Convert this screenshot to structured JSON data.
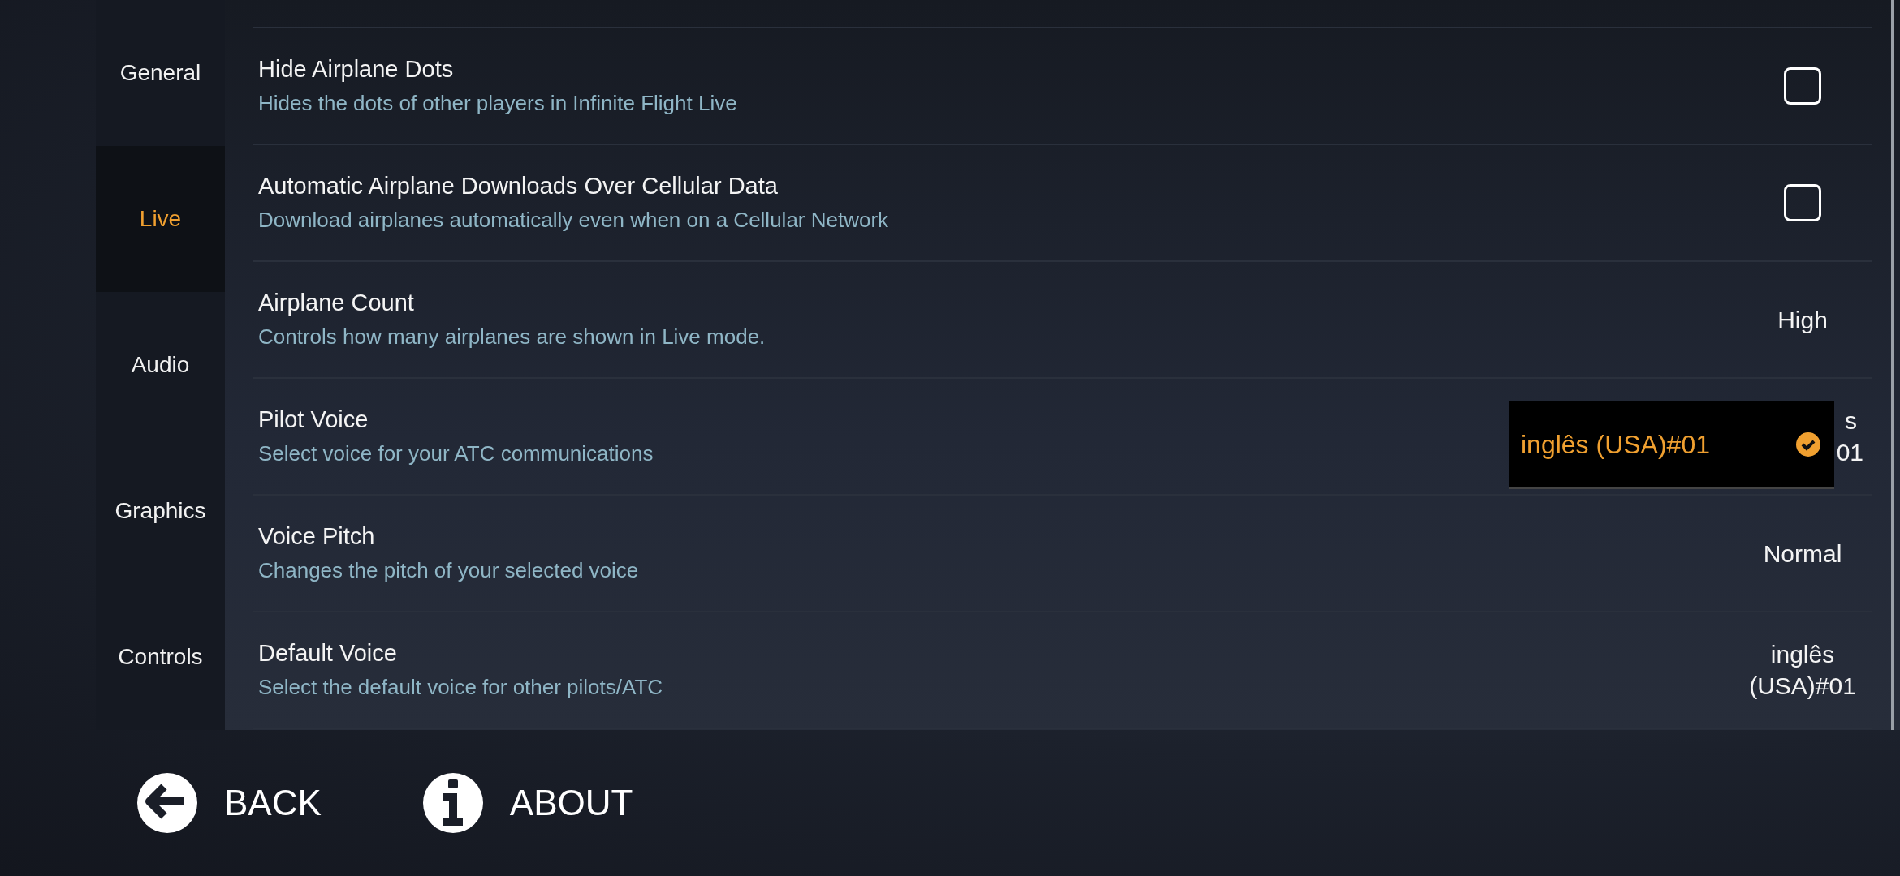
{
  "sidebar": {
    "items": [
      {
        "label": "General",
        "selected": false
      },
      {
        "label": "Live",
        "selected": true
      },
      {
        "label": "Audio",
        "selected": false
      },
      {
        "label": "Graphics",
        "selected": false
      },
      {
        "label": "Controls",
        "selected": false
      }
    ]
  },
  "settings": [
    {
      "kind": "checkbox",
      "title": "Hide Airplane Dots",
      "description": "Hides the dots of other players in Infinite Flight Live",
      "checked": false
    },
    {
      "kind": "checkbox",
      "title": "Automatic Airplane Downloads Over Cellular Data",
      "description": "Download airplanes automatically even when on a Cellular Network",
      "checked": false
    },
    {
      "kind": "value",
      "title": "Airplane Count",
      "description": "Controls how many airplanes are shown in Live mode.",
      "value_lines": [
        "High"
      ]
    },
    {
      "kind": "dropdown",
      "title": "Pilot Voice",
      "description": "Select voice for your ATC communications",
      "value_lines": [
        "s",
        "01"
      ],
      "dropdown": {
        "option": "inglês (USA)#01",
        "selected": true
      }
    },
    {
      "kind": "value",
      "title": "Voice Pitch",
      "description": "Changes the pitch of your selected voice",
      "value_lines": [
        "Normal"
      ]
    },
    {
      "kind": "value",
      "title": "Default Voice",
      "description": "Select the default voice for other pilots/ATC",
      "value_lines": [
        "inglês",
        "(USA)#01"
      ]
    }
  ],
  "footer": {
    "buttons": [
      {
        "kind": "back",
        "label": "BACK"
      },
      {
        "kind": "about",
        "label": "ABOUT"
      }
    ]
  }
}
